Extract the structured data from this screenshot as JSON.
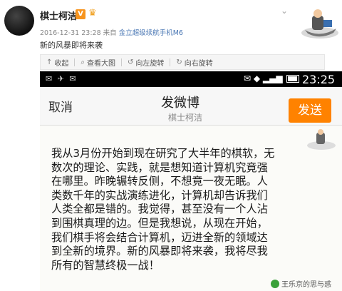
{
  "post": {
    "author": "棋士柯洁",
    "vip_badge": "V",
    "timestamp": "2016-12-31 23:28",
    "source_prefix": "来自",
    "device": "金立超级续航手机M6",
    "text": "新的风暴即将来袭",
    "dropdown_glyph": "⌄"
  },
  "toolbar": {
    "items": [
      {
        "icon": "arrow-up-icon",
        "glyph": "↑",
        "label": "收起"
      },
      {
        "icon": "zoom-icon",
        "glyph": "⌕",
        "label": "查看大图"
      },
      {
        "icon": "rotate-left-icon",
        "glyph": "↺",
        "label": "向左旋转"
      },
      {
        "icon": "rotate-right-icon",
        "glyph": "↻",
        "label": "向右旋转"
      }
    ]
  },
  "screenshot": {
    "status_left": "✉ ✈ ✉",
    "status_right": "✉ ◆ ▂▄▆",
    "time": "23:25",
    "cancel_label": "取消",
    "title": "发微博",
    "subtitle": "棋士柯洁",
    "send_label": "发送",
    "send_color": "#ff8200",
    "body_lines": [
      "我从3月份开始到现在研究了大半年的棋软，无",
      "数次的理论、实践，就是想知道计算机究竟强",
      "在哪里。昨晚辗转反侧，不想竟一夜无眠。人",
      "类数千年的实战演练进化，计算机却告诉我们",
      "人类全都是错的。我觉得，甚至没有一个人沾",
      "到围棋真理的边。但是我想说，从现在开始，",
      "我们棋手将会结合计算机，迈进全新的领域达",
      "到全新的境界。新的风暴即将来袭，我将尽我",
      "所有的智慧终极一战！"
    ]
  },
  "watermark": "王乐京的思与惑"
}
